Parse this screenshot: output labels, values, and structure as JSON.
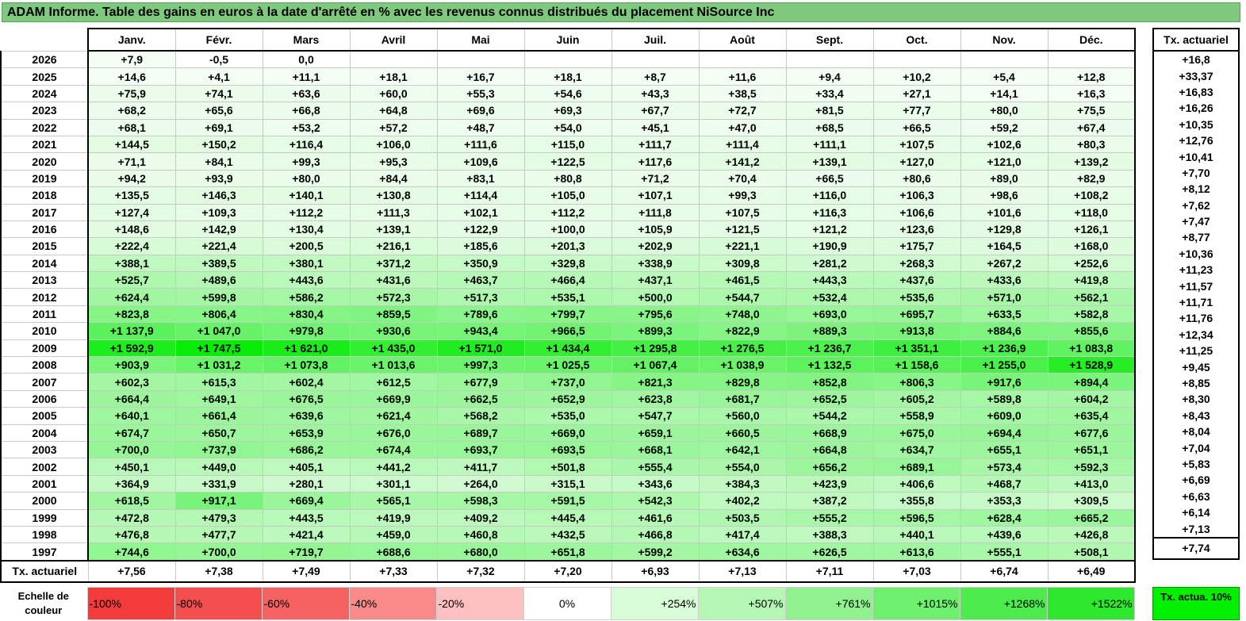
{
  "title": "ADAM Informe. Table des gains en euros à la date d'arrêté en % avec les revenus connus distribués du placement NiSource Inc",
  "months": [
    "Janv.",
    "Févr.",
    "Mars",
    "Avril",
    "Mai",
    "Juin",
    "Juil.",
    "Août",
    "Sept.",
    "Oct.",
    "Nov.",
    "Déc."
  ],
  "side_header": "Tx. actuariel",
  "avg_label": "Tx. actuariel",
  "rows": [
    {
      "year": "2026",
      "values": [
        "+7,9",
        "-0,5",
        "0,0",
        "",
        "",
        "",
        "",
        "",
        "",
        "",
        "",
        ""
      ],
      "rate": "+16,8"
    },
    {
      "year": "2025",
      "values": [
        "+14,6",
        "+4,1",
        "+11,1",
        "+18,1",
        "+16,7",
        "+18,1",
        "+8,7",
        "+11,6",
        "+9,4",
        "+10,2",
        "+5,4",
        "+12,8"
      ],
      "rate": "+33,37"
    },
    {
      "year": "2024",
      "values": [
        "+75,9",
        "+74,1",
        "+63,6",
        "+60,0",
        "+55,3",
        "+54,6",
        "+43,3",
        "+38,5",
        "+33,4",
        "+27,1",
        "+14,1",
        "+16,3"
      ],
      "rate": "+16,83"
    },
    {
      "year": "2023",
      "values": [
        "+68,2",
        "+65,6",
        "+66,8",
        "+64,8",
        "+69,6",
        "+69,3",
        "+67,7",
        "+72,7",
        "+81,5",
        "+77,7",
        "+80,0",
        "+75,5"
      ],
      "rate": "+16,26"
    },
    {
      "year": "2022",
      "values": [
        "+68,1",
        "+69,1",
        "+53,2",
        "+57,2",
        "+48,7",
        "+54,0",
        "+45,1",
        "+47,0",
        "+68,5",
        "+66,5",
        "+59,2",
        "+67,4"
      ],
      "rate": "+10,35"
    },
    {
      "year": "2021",
      "values": [
        "+144,5",
        "+150,2",
        "+116,4",
        "+106,0",
        "+111,6",
        "+115,0",
        "+111,7",
        "+111,4",
        "+111,1",
        "+107,5",
        "+102,6",
        "+80,3"
      ],
      "rate": "+12,76"
    },
    {
      "year": "2020",
      "values": [
        "+71,1",
        "+84,1",
        "+99,3",
        "+95,3",
        "+109,6",
        "+122,5",
        "+117,6",
        "+141,2",
        "+139,1",
        "+127,0",
        "+121,0",
        "+139,2"
      ],
      "rate": "+10,41"
    },
    {
      "year": "2019",
      "values": [
        "+94,2",
        "+93,9",
        "+80,0",
        "+84,4",
        "+83,1",
        "+80,8",
        "+71,2",
        "+70,4",
        "+66,5",
        "+80,6",
        "+89,0",
        "+82,9"
      ],
      "rate": "+7,70"
    },
    {
      "year": "2018",
      "values": [
        "+135,5",
        "+146,3",
        "+140,1",
        "+130,8",
        "+114,4",
        "+105,0",
        "+107,1",
        "+99,3",
        "+116,0",
        "+106,3",
        "+98,6",
        "+108,2"
      ],
      "rate": "+8,12"
    },
    {
      "year": "2017",
      "values": [
        "+127,4",
        "+109,3",
        "+112,2",
        "+111,3",
        "+102,1",
        "+112,2",
        "+111,8",
        "+107,5",
        "+116,3",
        "+106,6",
        "+101,6",
        "+118,0"
      ],
      "rate": "+7,62"
    },
    {
      "year": "2016",
      "values": [
        "+148,6",
        "+142,9",
        "+130,4",
        "+139,1",
        "+122,9",
        "+100,0",
        "+105,9",
        "+121,5",
        "+121,2",
        "+123,6",
        "+129,8",
        "+126,1"
      ],
      "rate": "+7,47"
    },
    {
      "year": "2015",
      "values": [
        "+222,4",
        "+221,4",
        "+200,5",
        "+216,1",
        "+185,6",
        "+201,3",
        "+202,9",
        "+221,1",
        "+190,9",
        "+175,7",
        "+164,5",
        "+168,0"
      ],
      "rate": "+8,77"
    },
    {
      "year": "2014",
      "values": [
        "+388,1",
        "+389,5",
        "+380,1",
        "+371,2",
        "+350,9",
        "+329,8",
        "+338,9",
        "+309,8",
        "+281,2",
        "+268,3",
        "+267,2",
        "+252,6"
      ],
      "rate": "+10,36"
    },
    {
      "year": "2013",
      "values": [
        "+525,7",
        "+489,6",
        "+443,6",
        "+431,6",
        "+463,7",
        "+466,4",
        "+437,1",
        "+461,5",
        "+443,3",
        "+437,6",
        "+433,6",
        "+419,8"
      ],
      "rate": "+11,23"
    },
    {
      "year": "2012",
      "values": [
        "+624,4",
        "+599,8",
        "+586,2",
        "+572,3",
        "+517,3",
        "+535,1",
        "+500,0",
        "+544,7",
        "+532,4",
        "+535,6",
        "+571,0",
        "+562,1"
      ],
      "rate": "+11,57"
    },
    {
      "year": "2011",
      "values": [
        "+823,8",
        "+806,4",
        "+830,4",
        "+859,5",
        "+789,6",
        "+799,7",
        "+795,6",
        "+748,0",
        "+693,0",
        "+695,7",
        "+633,5",
        "+582,8"
      ],
      "rate": "+11,71"
    },
    {
      "year": "2010",
      "values": [
        "+1 137,9",
        "+1 047,0",
        "+979,8",
        "+930,6",
        "+943,4",
        "+966,5",
        "+899,3",
        "+822,9",
        "+889,3",
        "+913,8",
        "+884,6",
        "+855,6"
      ],
      "rate": "+11,76"
    },
    {
      "year": "2009",
      "values": [
        "+1 592,9",
        "+1 747,5",
        "+1 621,0",
        "+1 435,0",
        "+1 571,0",
        "+1 434,4",
        "+1 295,8",
        "+1 276,5",
        "+1 236,7",
        "+1 351,1",
        "+1 236,9",
        "+1 083,8"
      ],
      "rate": "+12,34"
    },
    {
      "year": "2008",
      "values": [
        "+903,9",
        "+1 031,2",
        "+1 073,8",
        "+1 013,6",
        "+997,3",
        "+1 025,5",
        "+1 067,4",
        "+1 038,9",
        "+1 132,5",
        "+1 158,6",
        "+1 255,0",
        "+1 528,9"
      ],
      "rate": "+11,25"
    },
    {
      "year": "2007",
      "values": [
        "+602,3",
        "+615,3",
        "+602,4",
        "+612,5",
        "+677,9",
        "+737,0",
        "+821,3",
        "+829,8",
        "+852,8",
        "+806,3",
        "+917,6",
        "+894,4"
      ],
      "rate": "+9,45"
    },
    {
      "year": "2006",
      "values": [
        "+664,4",
        "+649,1",
        "+676,5",
        "+669,9",
        "+662,5",
        "+652,9",
        "+623,8",
        "+681,7",
        "+652,5",
        "+605,2",
        "+589,8",
        "+604,2"
      ],
      "rate": "+8,85"
    },
    {
      "year": "2005",
      "values": [
        "+640,1",
        "+661,4",
        "+639,6",
        "+621,4",
        "+568,2",
        "+535,0",
        "+547,7",
        "+560,0",
        "+544,2",
        "+558,9",
        "+609,0",
        "+635,4"
      ],
      "rate": "+8,30"
    },
    {
      "year": "2004",
      "values": [
        "+674,7",
        "+650,7",
        "+653,9",
        "+676,0",
        "+689,7",
        "+669,0",
        "+659,1",
        "+660,5",
        "+668,9",
        "+675,0",
        "+694,4",
        "+677,6"
      ],
      "rate": "+8,43"
    },
    {
      "year": "2003",
      "values": [
        "+700,0",
        "+737,9",
        "+686,2",
        "+674,4",
        "+693,7",
        "+693,5",
        "+668,1",
        "+642,1",
        "+664,8",
        "+634,7",
        "+655,1",
        "+651,1"
      ],
      "rate": "+8,04"
    },
    {
      "year": "2002",
      "values": [
        "+450,1",
        "+449,0",
        "+405,1",
        "+441,2",
        "+411,7",
        "+501,8",
        "+555,4",
        "+554,0",
        "+656,2",
        "+689,1",
        "+573,4",
        "+592,3"
      ],
      "rate": "+7,04"
    },
    {
      "year": "2001",
      "values": [
        "+364,9",
        "+331,9",
        "+280,1",
        "+301,1",
        "+264,0",
        "+315,1",
        "+343,6",
        "+384,3",
        "+423,9",
        "+406,6",
        "+468,7",
        "+413,0"
      ],
      "rate": "+5,83"
    },
    {
      "year": "2000",
      "values": [
        "+618,5",
        "+917,1",
        "+669,4",
        "+565,1",
        "+598,3",
        "+591,5",
        "+542,3",
        "+402,2",
        "+387,2",
        "+355,8",
        "+353,3",
        "+309,5"
      ],
      "rate": "+6,69"
    },
    {
      "year": "1999",
      "values": [
        "+472,8",
        "+479,3",
        "+443,5",
        "+419,9",
        "+409,2",
        "+445,4",
        "+461,6",
        "+503,5",
        "+555,2",
        "+596,5",
        "+628,4",
        "+665,2"
      ],
      "rate": "+6,63"
    },
    {
      "year": "1998",
      "values": [
        "+476,8",
        "+477,7",
        "+421,4",
        "+459,0",
        "+460,8",
        "+432,5",
        "+466,8",
        "+417,4",
        "+388,3",
        "+440,1",
        "+439,6",
        "+426,8"
      ],
      "rate": "+6,14"
    },
    {
      "year": "1997",
      "values": [
        "+744,6",
        "+700,0",
        "+719,7",
        "+688,6",
        "+680,0",
        "+651,8",
        "+599,2",
        "+634,6",
        "+626,5",
        "+613,6",
        "+555,1",
        "+508,1"
      ],
      "rate": "+7,13"
    }
  ],
  "avg_values": [
    "+7,56",
    "+7,38",
    "+7,49",
    "+7,33",
    "+7,32",
    "+7,20",
    "+6,93",
    "+7,13",
    "+7,11",
    "+7,03",
    "+6,74",
    "+6,49"
  ],
  "avg_total": "+7,74",
  "scale": {
    "label": "Echelle de couleur",
    "steps": [
      {
        "text": "-100%",
        "color": "#f23c3c"
      },
      {
        "text": "-80%",
        "color": "#f44e4e"
      },
      {
        "text": "-60%",
        "color": "#f66262"
      },
      {
        "text": "-40%",
        "color": "#f98a8a"
      },
      {
        "text": "-20%",
        "color": "#fcc0c0"
      },
      {
        "text": "0%",
        "color": "#ffffff"
      },
      {
        "text": "+254%",
        "color": "#d8fbd8"
      },
      {
        "text": "+507%",
        "color": "#b4f7b4"
      },
      {
        "text": "+761%",
        "color": "#8ff28f"
      },
      {
        "text": "+1015%",
        "color": "#6eef6e"
      },
      {
        "text": "+1268%",
        "color": "#4eeb4e"
      },
      {
        "text": "+1522%",
        "color": "#2ee82e"
      }
    ],
    "note": "Tx. actua. 10%"
  },
  "colors": {
    "title_bg": "#7fc97f",
    "scale_note_bg": "#00f000"
  }
}
